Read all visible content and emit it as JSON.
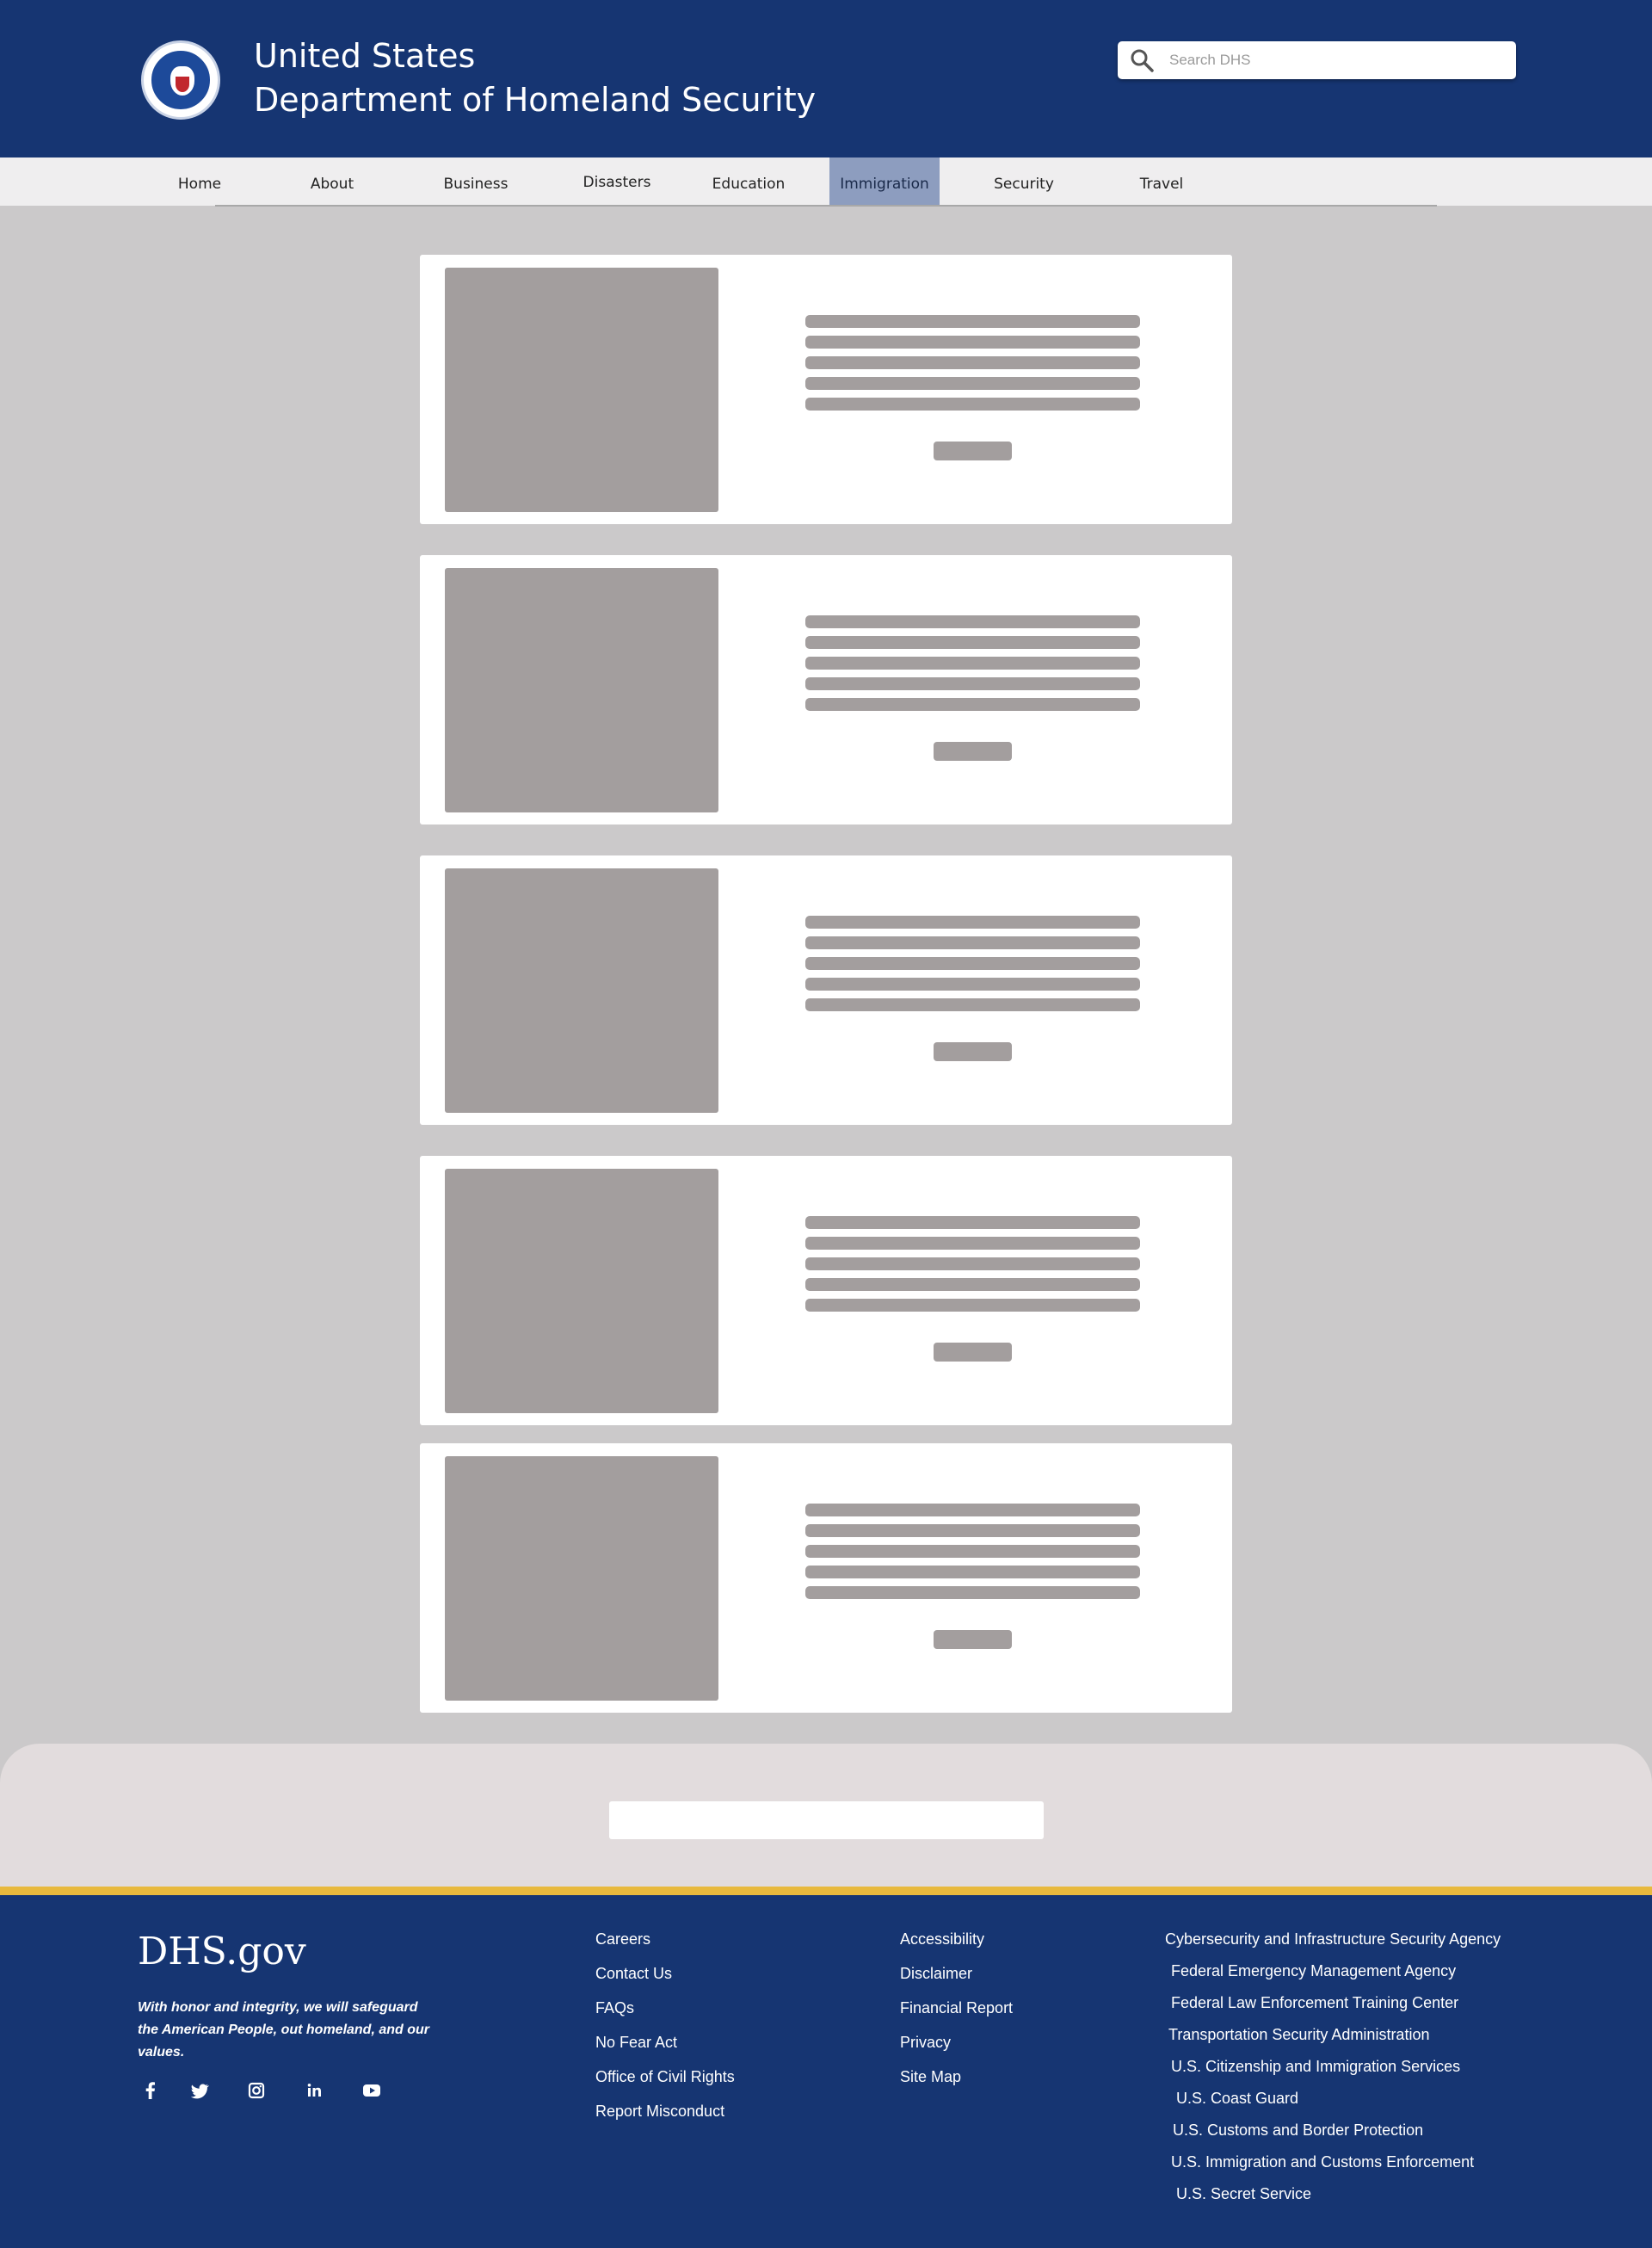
{
  "header": {
    "title_line1": "United States",
    "title_line2": "Department of Homeland Security",
    "search_placeholder": "Search DHS"
  },
  "nav": {
    "items": [
      {
        "label": "Home"
      },
      {
        "label": "About"
      },
      {
        "label": "Business"
      },
      {
        "label": "Disasters"
      },
      {
        "label": "Education"
      },
      {
        "label": "Immigration",
        "active": true
      },
      {
        "label": "Security"
      },
      {
        "label": "Travel"
      }
    ]
  },
  "footer": {
    "logo": "DHS.gov",
    "tagline": "With honor and integrity, we will safeguard the American People, out homeland, and our values.",
    "social": [
      "facebook-icon",
      "twitter-icon",
      "instagram-icon",
      "linkedin-icon",
      "youtube-icon"
    ],
    "col1": [
      "Careers",
      "Contact Us",
      "FAQs",
      "No Fear Act",
      "Office of Civil Rights",
      "Report Misconduct"
    ],
    "col2": [
      "Accessibility",
      "Disclaimer",
      "Financial Report",
      "Privacy",
      "Site Map"
    ],
    "agencies": [
      "Cybersecurity and Infrastructure Security Agency",
      "Federal Emergency Management Agency",
      "Federal Law Enforcement Training Center",
      "Transportation Security Administration",
      "U.S. Citizenship and Immigration Services",
      "U.S. Coast Guard",
      "U.S. Customs and Border Protection",
      "U.S. Immigration and Customs Enforcement",
      "U.S. Secret Service"
    ]
  },
  "colors": {
    "header_bg": "#163572",
    "nav_active": "#8d9dbf",
    "page_bg": "#cbc9ca",
    "placeholder": "#a39e9e",
    "gold": "#e8b93d"
  }
}
